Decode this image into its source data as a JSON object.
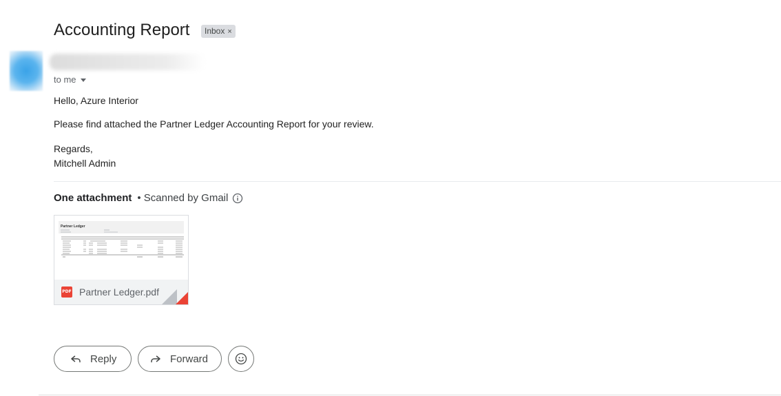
{
  "email": {
    "subject": "Accounting Report",
    "label": "Inbox",
    "label_remove": "×",
    "recipient_text": "to me",
    "greeting": "Hello, Azure Interior",
    "message": "Please find attached the Partner Ledger Accounting Report for your review.",
    "signoff": "Regards,",
    "signature": "Mitchell Admin"
  },
  "attachments": {
    "heading": "One attachment",
    "scanned_text": "• Scanned by Gmail",
    "file": {
      "name": "Partner Ledger.pdf",
      "type_badge": "PDF",
      "preview_title": "Partner Ledger"
    }
  },
  "actions": {
    "reply_label": "Reply",
    "forward_label": "Forward"
  },
  "colors": {
    "pdf_red": "#ea4335",
    "chip_bg": "#dadce0",
    "button_border": "#747775"
  },
  "icons": {
    "info": "info-icon",
    "reply": "reply-icon",
    "forward": "forward-icon",
    "emoji": "emoji-reaction-icon",
    "caret": "chevron-down-icon"
  }
}
